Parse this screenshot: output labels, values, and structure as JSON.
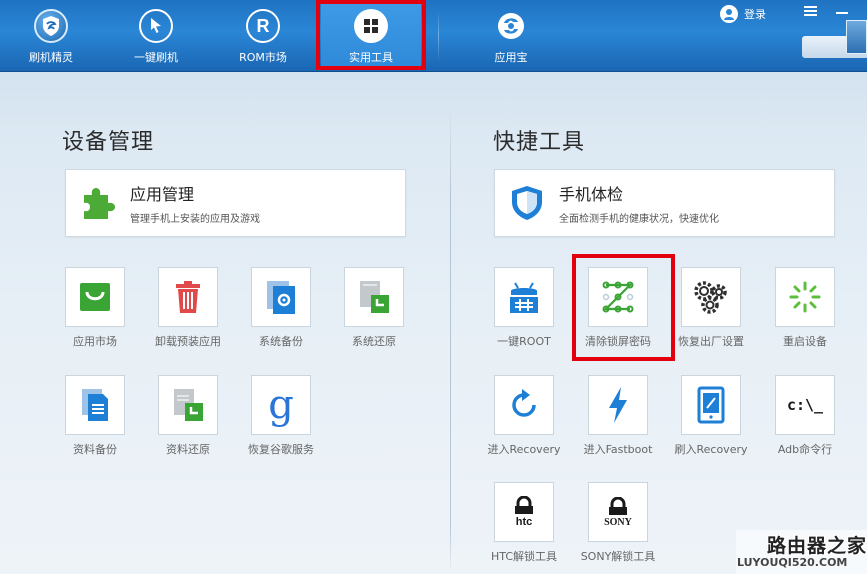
{
  "nav": {
    "items": [
      {
        "label": "刷机精灵"
      },
      {
        "label": "一键刷机"
      },
      {
        "label": "ROM市场"
      },
      {
        "label": "实用工具"
      },
      {
        "label": "应用宝"
      }
    ],
    "active_index": 3,
    "login_label": "登录"
  },
  "left": {
    "title": "设备管理",
    "card": {
      "title": "应用管理",
      "subtitle": "管理手机上安装的应用及游戏"
    },
    "tiles": [
      {
        "label": "应用市场"
      },
      {
        "label": "卸载预装应用"
      },
      {
        "label": "系统备份"
      },
      {
        "label": "系统还原"
      },
      {
        "label": "资料备份"
      },
      {
        "label": "资料还原"
      },
      {
        "label": "恢复谷歌服务"
      }
    ]
  },
  "right": {
    "title": "快捷工具",
    "card": {
      "title": "手机体检",
      "subtitle": "全面检测手机的健康状况，快速优化"
    },
    "tiles": [
      {
        "label": "一键ROOT"
      },
      {
        "label": "清除锁屏密码"
      },
      {
        "label": "恢复出厂设置"
      },
      {
        "label": "重启设备"
      },
      {
        "label": "进入Recovery"
      },
      {
        "label": "进入Fastboot"
      },
      {
        "label": "刷入Recovery"
      },
      {
        "label": "Adb命令行",
        "icon_text": "c:\\_"
      },
      {
        "label": "HTC解锁工具",
        "icon_text": "htc"
      },
      {
        "label": "SONY解锁工具",
        "icon_text": "SONY"
      }
    ]
  },
  "watermark": {
    "title": "路由器之家",
    "url": "LUYOUQI520.COM"
  },
  "colors": {
    "nav_blue": "#1f73c2",
    "highlight_red": "#e2000f",
    "tile_green": "#3aa435",
    "tile_blue": "#1e7fd6"
  }
}
